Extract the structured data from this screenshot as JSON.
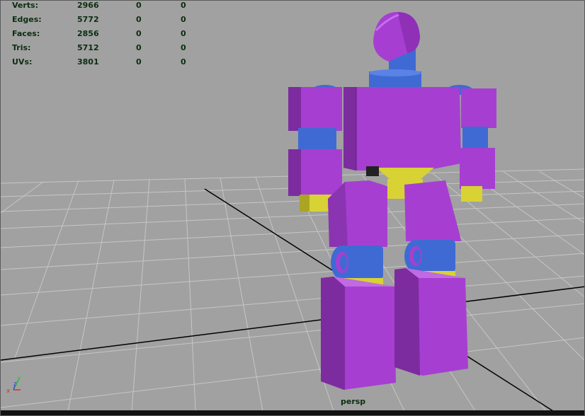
{
  "hud": {
    "rows": [
      {
        "label": "Verts:",
        "v1": "2966",
        "v2": "0",
        "v3": "0"
      },
      {
        "label": "Edges:",
        "v1": "5772",
        "v2": "0",
        "v3": "0"
      },
      {
        "label": "Faces:",
        "v1": "2856",
        "v2": "0",
        "v3": "0"
      },
      {
        "label": "Tris:",
        "v1": "5712",
        "v2": "0",
        "v3": "0"
      },
      {
        "label": "UVs:",
        "v1": "3801",
        "v2": "0",
        "v3": "0"
      }
    ]
  },
  "camera": {
    "name": "persp"
  },
  "axis": {
    "x": "x",
    "y": "y",
    "z": "z"
  },
  "colors": {
    "background": "#a1a1a1",
    "grid": "#c3c3c3",
    "axis_line": "#000000",
    "hud_text": "#0b2d10",
    "robot_purple": "#a63fd1",
    "robot_blue": "#3f6ad4",
    "robot_yellow": "#d8d235"
  }
}
